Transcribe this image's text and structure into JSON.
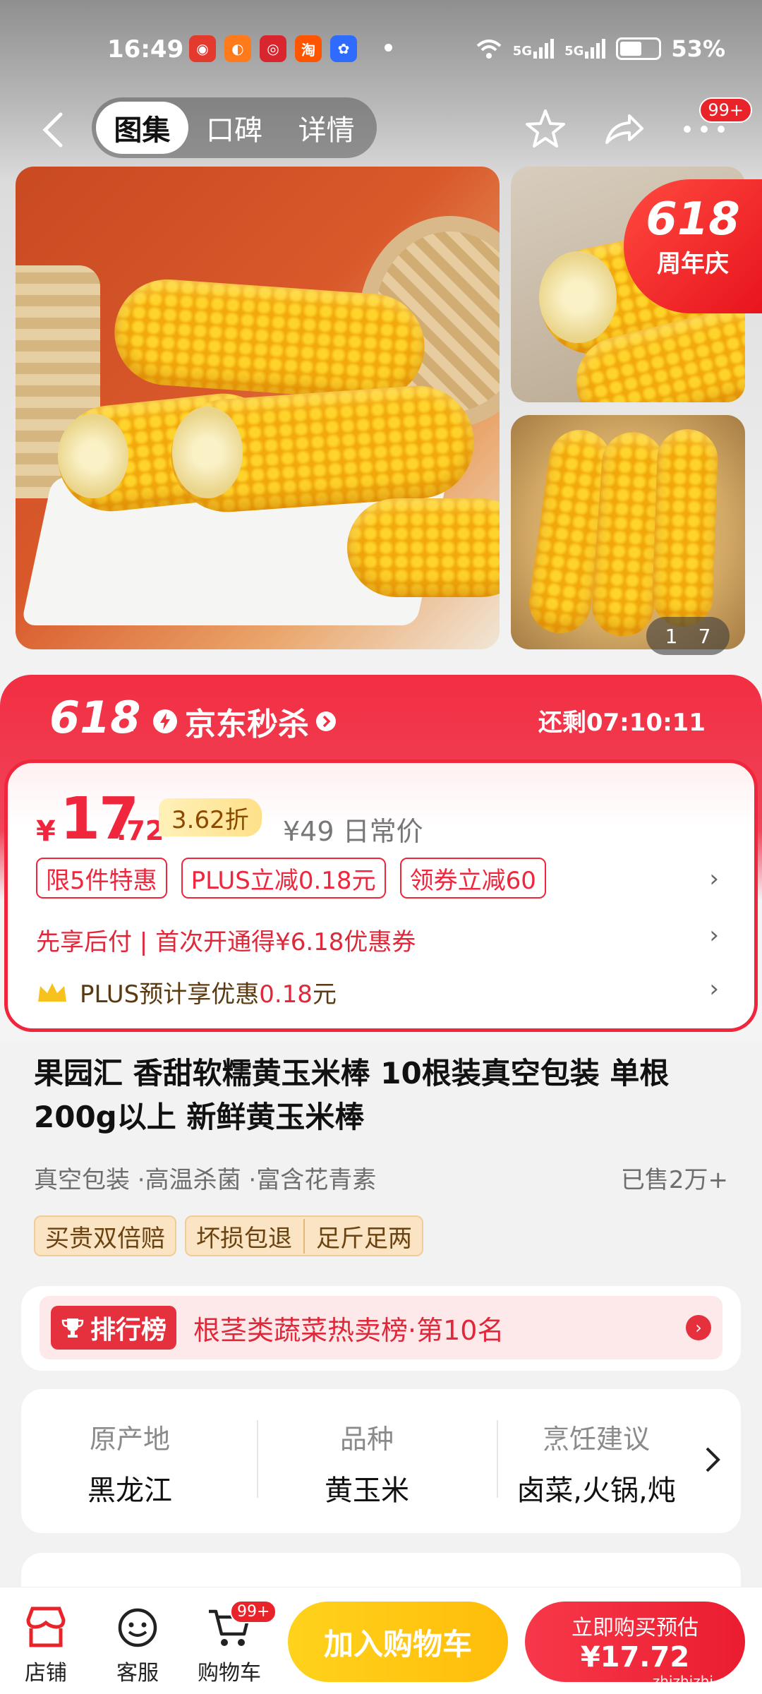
{
  "status": {
    "time": "16:49",
    "network": "5G",
    "network2": "5G",
    "battery": "53%"
  },
  "status_icons": [
    "weibo-icon",
    "orange-app-icon",
    "weibo-hot-icon",
    "taobao-icon",
    "baidu-icon"
  ],
  "nav": {
    "tabs": [
      {
        "label": "图集",
        "active": true
      },
      {
        "label": "口碑"
      },
      {
        "label": "详情"
      }
    ],
    "notif_badge": "99+"
  },
  "gallery": {
    "badge_top": "618",
    "badge_bottom": "周年庆",
    "current": "1",
    "total": "7"
  },
  "flash": {
    "logo": "618",
    "title": "京东秒杀",
    "countdown": "还剩07:10:11"
  },
  "price": {
    "currency": "¥",
    "integer": "17",
    "decimal": ".72",
    "discount": "3.62折",
    "original": "¥49",
    "original_label": "日常价"
  },
  "promo_tags": [
    "限5件特惠",
    "PLUS立减0.18元",
    "领券立减60"
  ],
  "pay_later": "先享后付 | 首次开通得¥6.18优惠券",
  "plus_line": {
    "prefix": "PLUS预计享优惠",
    "amount": "0.18",
    "suffix": "元"
  },
  "product": {
    "title": "果园汇 香甜软糯黄玉米棒 10根装真空包装 单根200g以上 新鲜黄玉米棒",
    "features": "真空包装 ·高温杀菌 ·富含花青素",
    "sold": "已售2万+",
    "guarantees": [
      "买贵双倍赔",
      "坏损包退",
      "足斤足两"
    ]
  },
  "rank": {
    "label": "排行榜",
    "text": "根茎类蔬菜热卖榜·第10名"
  },
  "specs": [
    {
      "key": "原产地",
      "value": "黑龙江"
    },
    {
      "key": "品种",
      "value": "黄玉米"
    },
    {
      "key": "烹饪建议",
      "value": "卤菜,火锅,炖"
    }
  ],
  "bottom": {
    "shop": "店铺",
    "service": "客服",
    "cart": "购物车",
    "cart_badge": "99+",
    "add_to_cart": "加入购物车",
    "buy_line1": "立即购买预估",
    "buy_line2": "¥17.72"
  },
  "watermark": "zhizhizhi.com",
  "colors": {
    "accent_red": "#f0263c",
    "button_yellow": "#ffc315"
  }
}
